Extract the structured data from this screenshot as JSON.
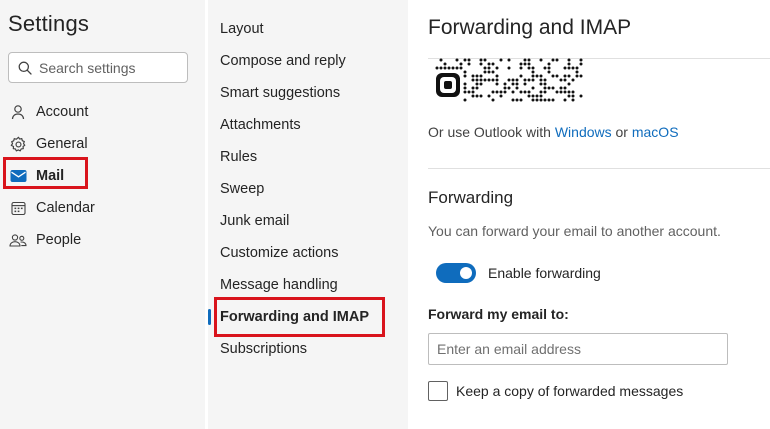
{
  "header": {
    "title": "Settings"
  },
  "search": {
    "placeholder": "Search settings"
  },
  "nav_left": [
    {
      "label": "Account",
      "icon": "person-icon"
    },
    {
      "label": "General",
      "icon": "gear-icon"
    },
    {
      "label": "Mail",
      "icon": "mail-icon",
      "selected": true
    },
    {
      "label": "Calendar",
      "icon": "calendar-icon"
    },
    {
      "label": "People",
      "icon": "people-icon"
    }
  ],
  "nav_mail": [
    {
      "label": "Layout"
    },
    {
      "label": "Compose and reply"
    },
    {
      "label": "Smart suggestions"
    },
    {
      "label": "Attachments"
    },
    {
      "label": "Rules"
    },
    {
      "label": "Sweep"
    },
    {
      "label": "Junk email"
    },
    {
      "label": "Customize actions"
    },
    {
      "label": "Message handling"
    },
    {
      "label": "Forwarding and IMAP",
      "selected": true
    },
    {
      "label": "Subscriptions"
    }
  ],
  "pane": {
    "title": "Forwarding and IMAP",
    "outlook_prefix": "Or use Outlook with ",
    "windows_link": "Windows",
    "or_word": " or ",
    "macos_link": "macOS",
    "forwarding": {
      "heading": "Forwarding",
      "description": "You can forward your email to another account.",
      "toggle_label": "Enable forwarding",
      "toggle_on": true,
      "field_label": "Forward my email to:",
      "email_placeholder": "Enter an email address",
      "email_value": "",
      "keep_copy_label": "Keep a copy of forwarded messages",
      "keep_copy_checked": false
    }
  },
  "colors": {
    "accent": "#0f6cbd",
    "highlight_box": "#d9141c",
    "sidebar_bg": "#f5f5f5"
  }
}
